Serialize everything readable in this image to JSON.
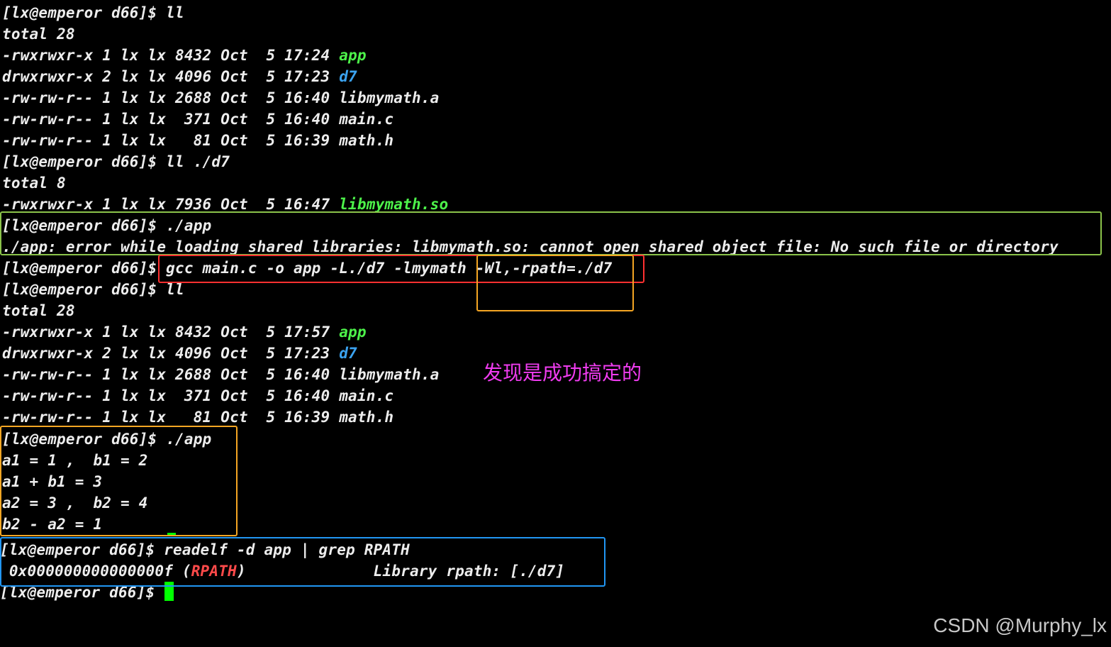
{
  "terminal": {
    "lines": [
      {
        "segments": [
          {
            "text": "[lx@emperor d66]$ ll"
          }
        ]
      },
      {
        "segments": [
          {
            "text": "total 28"
          }
        ]
      },
      {
        "segments": [
          {
            "text": "-rwxrwxr-x 1 lx lx 8432 Oct  5 17:24 "
          },
          {
            "text": "app"
          }
        ]
      },
      {
        "segments": [
          {
            "text": "drwxrwxr-x 2 lx lx 4096 Oct  5 17:23 "
          },
          {
            "text": "d7"
          }
        ]
      },
      {
        "segments": [
          {
            "text": "-rw-rw-r-- 1 lx lx 2688 Oct  5 16:40 libmymath.a"
          }
        ]
      },
      {
        "segments": [
          {
            "text": "-rw-rw-r-- 1 lx lx  371 Oct  5 16:40 main.c"
          }
        ]
      },
      {
        "segments": [
          {
            "text": "-rw-rw-r-- 1 lx lx   81 Oct  5 16:39 math.h"
          }
        ]
      },
      {
        "segments": [
          {
            "text": "[lx@emperor d66]$ ll ./d7"
          }
        ]
      },
      {
        "segments": [
          {
            "text": "total 8"
          }
        ]
      },
      {
        "segments": [
          {
            "text": "-rwxrwxr-x 1 lx lx 7936 Oct  5 16:47 "
          },
          {
            "text": "libmymath.so"
          }
        ]
      },
      {
        "segments": [
          {
            "text": "[lx@emperor d66]$ ./app"
          }
        ]
      },
      {
        "segments": [
          {
            "text": "./app: error while loading shared libraries: libmymath.so: cannot open shared object file: No such file or directory"
          }
        ]
      },
      {
        "segments": [
          {
            "text": "[lx@emperor d66]$ gcc main.c -o app -L./d7 -lmymath -Wl,-rpath=./d7"
          }
        ]
      },
      {
        "segments": [
          {
            "text": "[lx@emperor d66]$ ll"
          }
        ]
      },
      {
        "segments": [
          {
            "text": "total 28"
          }
        ]
      },
      {
        "segments": [
          {
            "text": "-rwxrwxr-x 1 lx lx 8432 Oct  5 17:57 "
          },
          {
            "text": "app"
          }
        ]
      },
      {
        "segments": [
          {
            "text": "drwxrwxr-x 2 lx lx 4096 Oct  5 17:23 "
          },
          {
            "text": "d7"
          }
        ]
      },
      {
        "segments": [
          {
            "text": "-rw-rw-r-- 1 lx lx 2688 Oct  5 16:40 libmymath.a"
          }
        ]
      },
      {
        "segments": [
          {
            "text": "-rw-rw-r-- 1 lx lx  371 Oct  5 16:40 main.c"
          }
        ]
      },
      {
        "segments": [
          {
            "text": "-rw-rw-r-- 1 lx lx   81 Oct  5 16:39 math.h"
          }
        ]
      },
      {
        "segments": [
          {
            "text": "[lx@emperor d66]$ ./app"
          }
        ]
      },
      {
        "segments": [
          {
            "text": "a1 = 1 ,  b1 = 2"
          }
        ]
      },
      {
        "segments": [
          {
            "text": "a1 + b1 = 3"
          }
        ]
      },
      {
        "segments": [
          {
            "text": "a2 = 3 ,  b2 = 4"
          }
        ]
      },
      {
        "segments": [
          {
            "text": "b2 - a2 = 1"
          }
        ]
      },
      {
        "segments": [
          {
            "text": "[lx@emperor d66]$ readelf -d app | grep RPATH"
          }
        ]
      },
      {
        "segments": [
          {
            "text": " 0x000000000000000f ("
          },
          {
            "text": "RPATH"
          },
          {
            "text": ")              Library rpath: [./d7]"
          }
        ]
      },
      {
        "segments": [
          {
            "text": "[lx@emperor d66]$ "
          }
        ]
      }
    ]
  },
  "annotation": "发现是成功搞定的",
  "watermark": "CSDN @Murphy_lx",
  "colors": {
    "background": "#000000",
    "text": "#ededed",
    "executable": "#4df24a",
    "directory": "#3ba3f0",
    "rpath_keyword": "#ff4a4a",
    "annotation": "#f03cf0",
    "box_green": "#8bc34a",
    "box_red": "#ff3030",
    "box_orange": "#f5a623",
    "box_blue": "#2196f3",
    "cursor": "#00ff00"
  }
}
